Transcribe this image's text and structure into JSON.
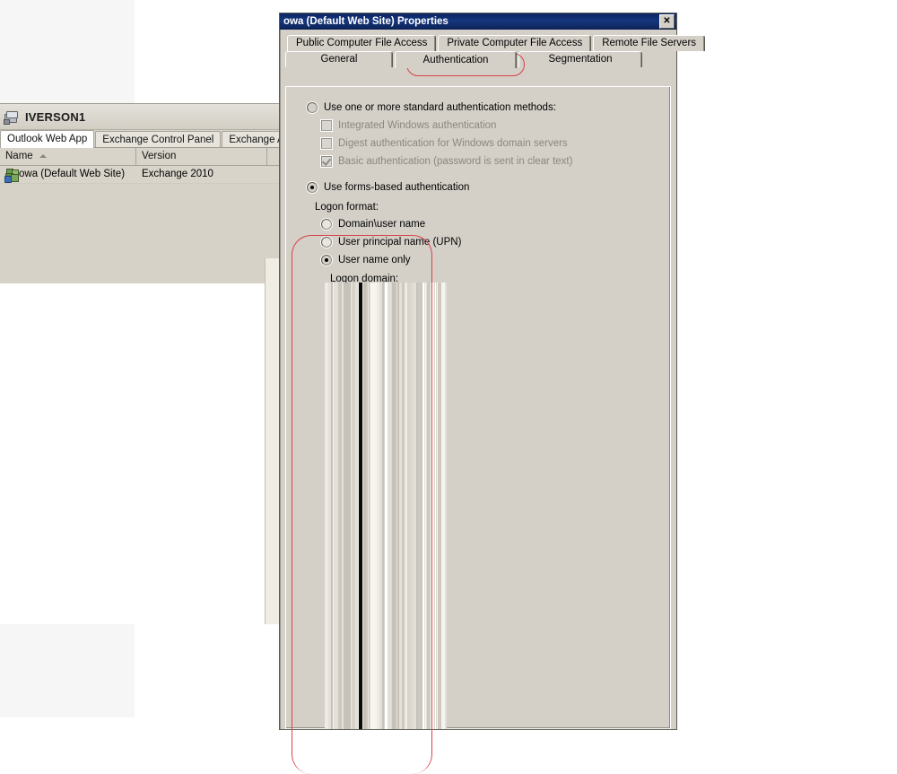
{
  "dialog": {
    "title": "owa (Default Web Site) Properties",
    "close_label": "✕",
    "tabs_row1": [
      {
        "label": "Public Computer File Access",
        "selected": false
      },
      {
        "label": "Private Computer File Access",
        "selected": false
      },
      {
        "label": "Remote File Servers",
        "selected": false
      }
    ],
    "tabs_row2": [
      {
        "label": "General",
        "selected": false
      },
      {
        "label": "Authentication",
        "selected": true
      },
      {
        "label": "Segmentation",
        "selected": false
      }
    ],
    "auth": {
      "standard_radio_label": "Use one or more standard authentication methods:",
      "standard_radio_selected": false,
      "checkboxes": [
        {
          "label": "Integrated Windows authentication",
          "checked": false,
          "disabled": true
        },
        {
          "label": "Digest authentication for Windows domain servers",
          "checked": false,
          "disabled": true
        },
        {
          "label": "Basic authentication (password is sent in clear text)",
          "checked": true,
          "disabled": true
        }
      ],
      "forms_radio_label": "Use forms-based authentication",
      "forms_radio_selected": true,
      "logon_format_label": "Logon format:",
      "logon_formats": [
        {
          "label": "Domain\\user name",
          "selected": false
        },
        {
          "label": "User principal name (UPN)",
          "selected": false
        },
        {
          "label": "User name only",
          "selected": true
        }
      ],
      "logon_domain_label": "Logon domain:",
      "logon_domain_value": ""
    }
  },
  "mmc": {
    "server_name": "IVERSON1",
    "tabs": [
      {
        "label": "Outlook Web App",
        "selected": true
      },
      {
        "label": "Exchange Control Panel",
        "selected": false
      },
      {
        "label": "Exchange ActiveS",
        "selected": false
      }
    ],
    "columns": [
      "Name",
      "Version"
    ],
    "rows": [
      {
        "name": "owa (Default Web Site)",
        "version": "Exchange 2010"
      }
    ]
  },
  "annotations": {
    "highlight_tab": "Authentication",
    "highlight_region": "User name only / Logon domain"
  },
  "colors": {
    "titlebar": "#16377f",
    "dialog_face": "#d4d0c8",
    "annotation_red": "#d8414a",
    "mmc_face": "#d6d2c8"
  }
}
